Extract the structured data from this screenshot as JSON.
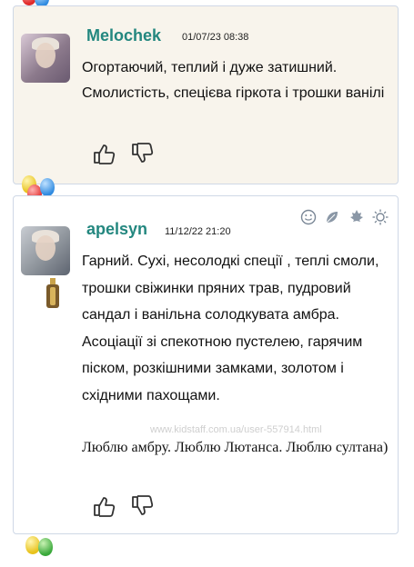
{
  "reviews": [
    {
      "username": "Melochek",
      "date": "01/07/23 08:38",
      "text": "Огортаючий, теплий і дуже затишний. Смолистість, спецієва гіркота і трошки ванілі"
    },
    {
      "username": "apelsyn",
      "date": "11/12/22 21:20",
      "text": "Гарний. Сухі, несолодкі спеції , теплі смоли, трошки свіжинки пряних трав, пудровий сандал і ванільна солодкувата амбра. Асоціації зі спекотною пустелею, гарячим піском, розкішними замками, золотом і східними пахощами.",
      "text2": "Люблю амбру. Люблю Лютанса. Люблю султана)"
    }
  ],
  "watermark": "www.kidstaff.com.ua/user-557914.html",
  "icons": {
    "like": "thumbs-up-icon",
    "dislike": "thumbs-down-icon",
    "tools": [
      "smiley-icon",
      "leaf-icon",
      "maple-leaf-icon",
      "sun-icon"
    ]
  },
  "colors": {
    "username": "#23877f",
    "card1_bg": "#f8f4ec",
    "card_border": "#cfd8e6"
  }
}
